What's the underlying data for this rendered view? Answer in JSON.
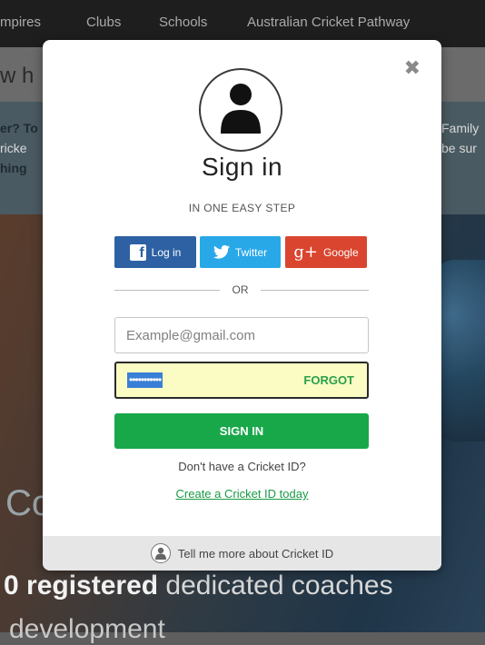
{
  "background": {
    "nav": {
      "items": [
        "mpires",
        "Clubs",
        "Schools",
        "Australian Cricket Pathway"
      ]
    },
    "heading_fragment": "w h",
    "info_left": [
      "er? To",
      "ricke",
      "hing"
    ],
    "info_right": [
      "Family",
      "be sur"
    ],
    "big_fragment": "Co",
    "registered_bold": "0 registered",
    "registered_rest": " dedicated coaches",
    "development_text": "development"
  },
  "modal": {
    "close_label": "✖",
    "title": "Sign in",
    "subtitle": "IN ONE EASY STEP",
    "social": {
      "facebook_label": "Log in",
      "twitter_label": "Twitter",
      "google_icon": "g+",
      "google_label": "Google"
    },
    "or_label": "OR",
    "email_placeholder": "Example@gmail.com",
    "password_mask": "•••••••••••",
    "forgot_label": "FORGOT",
    "signin_label": "SIGN IN",
    "no_account_text": "Don't have a Cricket ID?",
    "create_link": "Create a Cricket ID today",
    "footer_text": "Tell me more about Cricket ID"
  },
  "colors": {
    "facebook": "#2d61a3",
    "twitter": "#29a8e8",
    "google": "#d9452f",
    "signin_green": "#18a84a",
    "link_green": "#1a9a45",
    "autofill_yellow": "#fbfbc4"
  }
}
